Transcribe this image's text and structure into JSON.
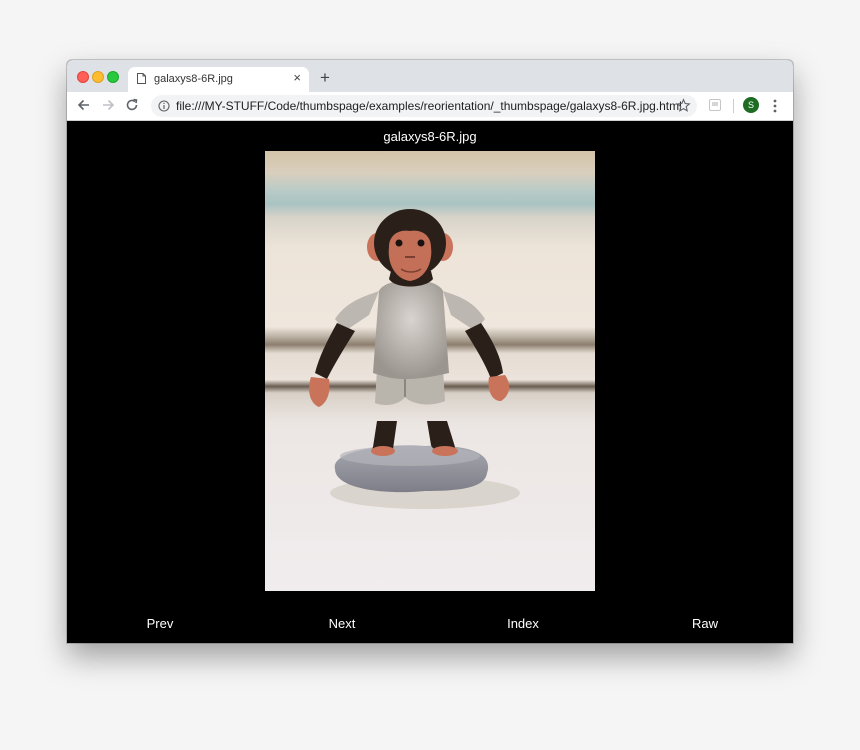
{
  "browser": {
    "tab_title": "galaxys8-6R.jpg",
    "tab_close": "×",
    "new_tab": "+",
    "url": "file:///MY-STUFF/Code/thumbspage/examples/reorientation/_thumbspage/galaxys8-6R.jpg.html",
    "profile_initial": "S"
  },
  "page": {
    "title": "galaxys8-6R.jpg",
    "nav": {
      "prev": "Prev",
      "next": "Next",
      "index": "Index",
      "raw": "Raw"
    }
  },
  "colors": {
    "page_background": "#000000",
    "chrome_tabstrip": "#dee1e6",
    "profile_avatar": "#1e6b23"
  },
  "icons": [
    "page-icon",
    "back-arrow-icon",
    "forward-arrow-icon",
    "reload-icon",
    "info-icon",
    "star-icon",
    "extension-icon",
    "menu-icon"
  ]
}
